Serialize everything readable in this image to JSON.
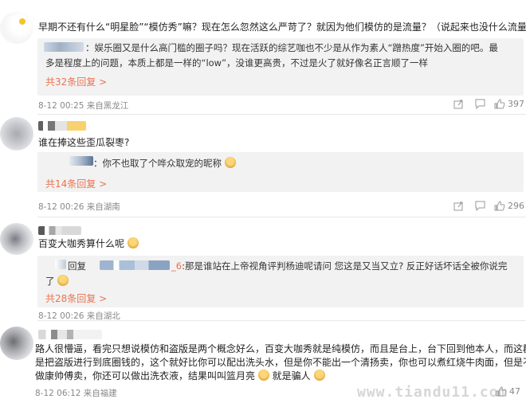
{
  "comments": [
    {
      "text": "早期不还有什么“明星脸”“模仿秀”嘛？现在怎么忽然这么严苛了？就因为他们模仿的是流量？（说起来也没什么流量了）",
      "reply_line1": "：娱乐圈又是什么高门槛的圈子吗？现在活跃的综艺咖也不少是从作为素人“蹭热度”开始入圈的吧。最",
      "reply_line2": "多是程度上的问题，本质上都是一样的“low”，没谁更高贵，不过是火了就好像名正言顺了一样",
      "more": "共32条回复 >",
      "meta": "8-12 00:25 来自黑龙江",
      "likes": "397"
    },
    {
      "text": "谁在捧这些歪瓜裂枣?",
      "reply_line1": "：你不也取了个哗众取宠的昵称",
      "more": "共14条回复 >",
      "meta": "8-12 00:26 来自湖南",
      "likes": "296"
    },
    {
      "text": "百变大咖秀算什么呢",
      "reply_prefix": "回复",
      "reply_name": "_6",
      "reply_line1": ":那是谁站在上帝视角评判杨迪呢请问 您这是又当又立? 反正好话坏话全被你说完",
      "reply_line2": "了",
      "more": "共28条回复 >",
      "meta": "8-12 00:26 来自湖北"
    },
    {
      "line1": "路人很懵逼，看完只想说模仿和盗版是两个概念好么，百变大咖秀就是纯模仿，而且是台上，台下回到他本人，而这群人",
      "line2": "是把盗版进行到底圈钱的，这个就好比你可以配出洗头水，但是你不能出一个清扬卖，你也可以煮红烧牛肉面，但是不能",
      "line3": "做康帅傅卖，你还可以做出洗衣液，结果叫叫篮月亮",
      "line3_tail": "就是骗人",
      "meta": "8-12 06:12 来自福建",
      "likes": "47"
    }
  ],
  "watermark": "www.tiandu11.com",
  "icons": [
    "share-icon",
    "comment-icon",
    "like-icon"
  ],
  "colors": {
    "accent": "#eb7350",
    "meta": "#888888",
    "reply_bg": "#f2f2f2"
  }
}
